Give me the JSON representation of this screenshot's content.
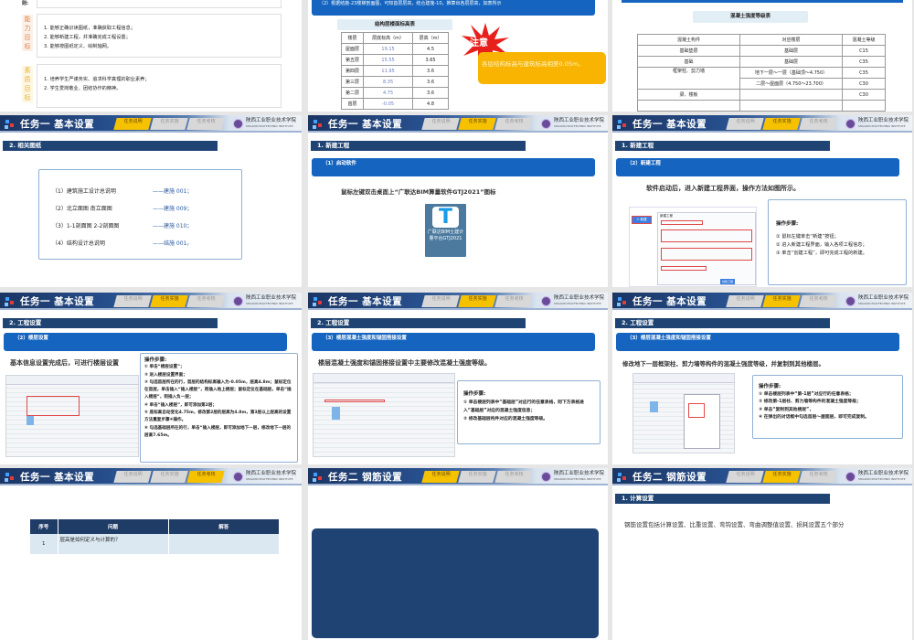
{
  "common": {
    "task1_title": "任务一  基本设置",
    "task2_title": "任务二  钢筋设置",
    "tabs": [
      "任务说明",
      "任务实施",
      "任务考核"
    ],
    "school_cn": "陕西工业职业技术学院",
    "school_en": "SHAANXI POLYTECHNIC INSTITUTE",
    "accent_active_tab": "#f6c200",
    "header_blue": "#1b3563"
  },
  "slide_goals": {
    "prev_label": "则:",
    "ability_label": "能力目标",
    "ability_items": [
      "1. 能够正确识读图纸，准确获取工程信息；",
      "2. 能够新建工程，并准确完成工程设置；",
      "3. 能够按图纸定义、绘制轴网。"
    ],
    "quality_label": "素质目标",
    "quality_items": [
      "1. 培养学生严谨务实、追求科学真理的职业素养；",
      "2. 学生爱岗敬业、团结协作的精神。"
    ]
  },
  "slide_floor_table": {
    "banner": "（2）根据结施-23楼梯剖面图，可知首层层高，结合建施-10，推算出各层层高，如表所示",
    "table_title": "结构层楼面标高表",
    "headers": [
      "楼层",
      "层底标高（m）",
      "层高（m）"
    ],
    "rows": [
      [
        "屋面层",
        "19.15",
        "4.5"
      ],
      [
        "第五层",
        "15.55",
        "3.65"
      ],
      [
        "第四层",
        "11.95",
        "3.6"
      ],
      [
        "第三层",
        "8.35",
        "3.6"
      ],
      [
        "第二层",
        "4.75",
        "3.6"
      ],
      [
        "首层",
        "-0.05",
        "4.8"
      ]
    ],
    "attention": "注意",
    "note": "各层结构标高与建筑标高相差0.05m。"
  },
  "slide_concrete_table": {
    "table_title": "混凝土强度等级表",
    "headers": [
      "混凝土构件",
      "对应楼层",
      "混凝土等级"
    ],
    "rows": [
      [
        "基础垫层",
        "基础层",
        "C15"
      ],
      [
        "基础",
        "基础层",
        "C35"
      ],
      [
        "框架柱、剪力墙",
        "地下一层～一层（基础顶～4.750）",
        "C35"
      ],
      [
        "",
        "二层～屋面层（4.750～23.700）",
        "C30"
      ],
      [
        "梁、楼板",
        "",
        "C30"
      ]
    ]
  },
  "slide_drawings": {
    "section": "2. 相关图纸",
    "items": [
      {
        "name": "（1）建筑施工设计总说明",
        "code": "——建施 001；"
      },
      {
        "name": "（2）北立面图 南立面图",
        "code": "——建施 009；"
      },
      {
        "name": "（3）1-1剖面图 2-2剖面图",
        "code": "——建施 010；"
      },
      {
        "name": "（4）结构设计总说明",
        "code": "——结施 001。"
      }
    ]
  },
  "slide_launch": {
    "section": "1. 新建工程",
    "sub": "（1）启动软件",
    "text": "鼠标左键双击桌面上“广联达BIM算量软件GTJ2021”图标",
    "icon_label": "广联达BIM土建计量平台GTJ2021"
  },
  "slide_new_project": {
    "section": "1. 新建工程",
    "sub": "（2）新建工程",
    "text": "软件启动后，进入新建工程界面，操作方法如图所示。",
    "steps_title": "操作步骤:",
    "steps": [
      "① 鼠标左键单击“新建”按钮；",
      "② 进入新建工程界面，输入各项工程信息；",
      "③ 单击“创建工程”，即可完成工程的新建。"
    ],
    "shot_button": "+ 新建",
    "shot_dialog": "新建工程",
    "shot_create": "创建工程"
  },
  "slide_floor_setting": {
    "section": "2. 工程设置",
    "sub": "（2）楼层设置",
    "text": "基本信息设置完成后，可进行楼层设置",
    "steps_title": "操作步骤:",
    "steps": [
      "① 单击“楼层设置”；",
      "② 进入楼层设置界面；",
      "③ 勾选首层所在的行，首层的结构标高输入为-0.05m，层高4.8m；鼠标定位在首层，单击插入“插入楼层”，则插入地上楼层；鼠标定位在基础层，单击“插入楼层”，则插入负一层；",
      "④ 单击“插入楼层”，即可添加第2层；",
      "⑤ 底标高自动变化4.75m，修改第2层的层高为4.8m，第3层以上层高的设置方法重复步骤④操作。",
      "⑥ 勾选基础层所在的行，单击“插入楼层，即可添加地下一层，修改地下一层的层高7.65m。"
    ]
  },
  "slide_concrete_setting": {
    "section": "2. 工程设置",
    "sub": "（3）楼层混凝土强度和锚固搭接设置",
    "text": "楼层混凝土强度和锚固搭接设置中主要修改混凝土强度等级。",
    "steps_title": "操作步骤:",
    "steps": [
      "① 单击楼层列表中“基础层”对应行的任意表格，则下方表格进入“基础层”对应的混凝土强度信息；",
      "② 修改基础层构件对应的混凝土强度等级。"
    ]
  },
  "slide_copy_floors": {
    "section": "2. 工程设置",
    "sub": "（3）楼层混凝土强度和锚固搭接设置",
    "text": "修改地下一层框架柱、剪力墙等构件的混凝土强度等级，并复制到其他楼层。",
    "steps_title": "操作步骤:",
    "steps": [
      "① 单击楼层列表中“第-1层”对应行的任意表格；",
      "② 修改第-1层柱、剪力墙等构件的混凝土强度等级；",
      "③ 单击“复制到其他楼层”，",
      "④ 在弹出的对话框中勾选首层～屋面层，即可完成复制。"
    ]
  },
  "slide_assessment": {
    "headers": [
      "序号",
      "问题",
      "解答"
    ],
    "rows": [
      [
        "1",
        "层高是如何定义与计算的？",
        ""
      ]
    ]
  },
  "slide_rebar_calc": {
    "section": "1. 计算设置",
    "text": "钢筋设置包括计算设置、比重设置、弯钩设置、弯曲调整值设置、损耗设置五个部分"
  }
}
